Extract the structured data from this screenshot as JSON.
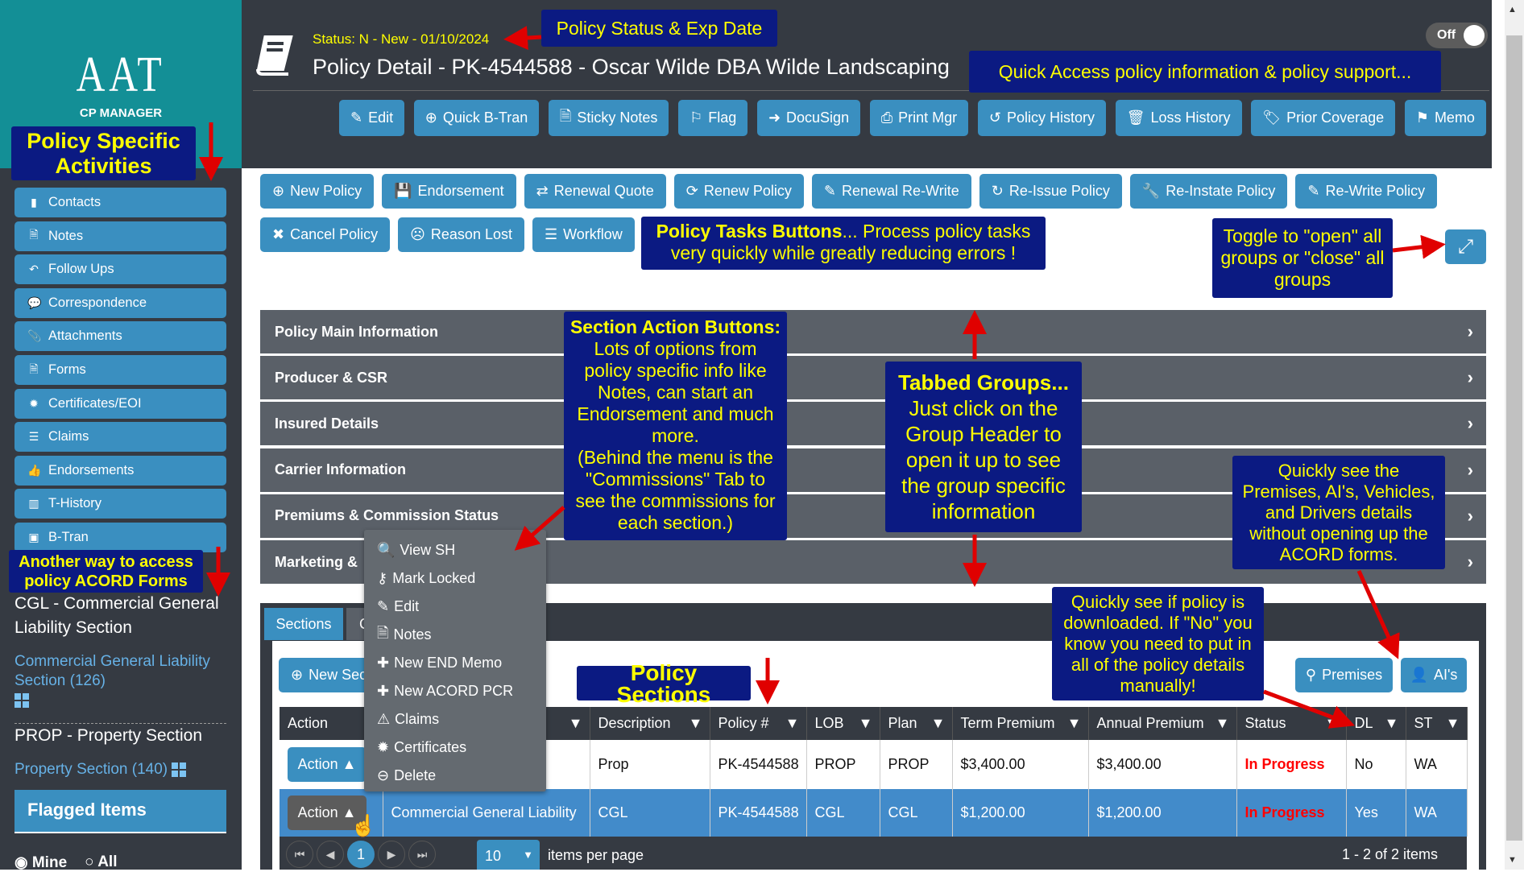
{
  "colors": {
    "accent": "#3a8fc0",
    "sidebar_bg": "#353a42",
    "brand_teal": "#138f96",
    "annotation_bg": "#0b1a82",
    "annotation_text": "#ffff00",
    "status_red": "#ff0000"
  },
  "logo": {
    "main": "AAT",
    "sub": "CP MANAGER"
  },
  "sidebar": {
    "items": [
      {
        "label": "Contacts",
        "icon": "address-book-icon"
      },
      {
        "label": "Notes",
        "icon": "file-icon"
      },
      {
        "label": "Follow Ups",
        "icon": "reply-icon"
      },
      {
        "label": "Correspondence",
        "icon": "comments-icon"
      },
      {
        "label": "Attachments",
        "icon": "paperclip-icon"
      },
      {
        "label": "Forms",
        "icon": "file-text-icon"
      },
      {
        "label": "Certificates/EOI",
        "icon": "certificate-icon"
      },
      {
        "label": "Claims",
        "icon": "list-icon"
      },
      {
        "label": "Endorsements",
        "icon": "thumbs-up-icon"
      },
      {
        "label": "T-History",
        "icon": "bar-chart-icon"
      },
      {
        "label": "B-Tran",
        "icon": "money-icon"
      }
    ],
    "sections": [
      {
        "title": "CGL - Commercial General Liability Section",
        "link": "Commercial General Liability Section (126)"
      },
      {
        "title": "PROP - Property Section",
        "link": "Property Section (140)"
      }
    ],
    "flagged_title": "Flagged Items",
    "radios": [
      {
        "label": "Mine",
        "checked": true
      },
      {
        "label": "All",
        "checked": false
      }
    ]
  },
  "header": {
    "status": "Status: N - New - 01/10/2024",
    "title": "Policy Detail - PK-4544588 - Oscar Wilde DBA Wilde Landscaping",
    "toggle_label": "Off",
    "buttons": [
      {
        "label": "Edit",
        "icon": "edit-icon"
      },
      {
        "label": "Quick B-Tran",
        "icon": "plus-circle-icon"
      },
      {
        "label": "Sticky Notes",
        "icon": "file-icon"
      },
      {
        "label": "Flag",
        "icon": "flag-icon"
      },
      {
        "label": "DocuSign",
        "icon": "sign-in-icon"
      },
      {
        "label": "Print Mgr",
        "icon": "print-icon"
      },
      {
        "label": "Policy History",
        "icon": "history-icon"
      },
      {
        "label": "Loss History",
        "icon": "trash-icon"
      },
      {
        "label": "Prior Coverage",
        "icon": "tags-icon"
      },
      {
        "label": "Memo",
        "icon": "bookmark-icon"
      }
    ]
  },
  "tasks": {
    "row1": [
      {
        "label": "New Policy",
        "icon": "plus-circle-icon"
      },
      {
        "label": "Endorsement",
        "icon": "save-icon"
      },
      {
        "label": "Renewal Quote",
        "icon": "retweet-icon"
      },
      {
        "label": "Renew Policy",
        "icon": "refresh-icon"
      },
      {
        "label": "Renewal Re-Write",
        "icon": "pencil-icon"
      },
      {
        "label": "Re-Issue Policy",
        "icon": "redo-icon"
      },
      {
        "label": "Re-Instate Policy",
        "icon": "wrench-icon"
      },
      {
        "label": "Re-Write Policy",
        "icon": "edit-square-icon"
      }
    ],
    "row2": [
      {
        "label": "Cancel Policy",
        "icon": "close-icon"
      },
      {
        "label": "Reason Lost",
        "icon": "frown-icon"
      },
      {
        "label": "Workflow",
        "icon": "tasks-icon"
      }
    ]
  },
  "groups": [
    "Policy Main Information",
    "Producer & CSR",
    "Insured Details",
    "Carrier Information",
    "Premiums & Commission Status",
    "Marketing & "
  ],
  "sections_panel": {
    "tabs": [
      "Sections",
      "C"
    ],
    "new_button": "New Sec",
    "premises_button": "Premises",
    "ais_button": "AI's",
    "columns": [
      "Action",
      "",
      "Description",
      "Policy #",
      "LOB",
      "Plan",
      "Term Premium",
      "Annual Premium",
      "Status",
      "DL",
      "ST"
    ],
    "rows": [
      {
        "action": "Action",
        "name": "",
        "description": "Prop",
        "policy": "PK-4544588",
        "lob": "PROP",
        "plan": "PROP",
        "term": "$3,400.00",
        "annual": "$3,400.00",
        "status": "In Progress",
        "dl": "No",
        "st": "WA"
      },
      {
        "action": "Action",
        "name": "Commercial General Liability",
        "description": "CGL",
        "policy": "PK-4544588",
        "lob": "CGL",
        "plan": "CGL",
        "term": "$1,200.00",
        "annual": "$1,200.00",
        "status": "In Progress",
        "dl": "Yes",
        "st": "WA"
      }
    ],
    "action_menu": [
      {
        "label": "View SH",
        "icon": "search-icon"
      },
      {
        "label": "Mark Locked",
        "icon": "key-icon"
      },
      {
        "label": "Edit",
        "icon": "edit-icon"
      },
      {
        "label": "Notes",
        "icon": "file-icon"
      },
      {
        "label": "New END Memo",
        "icon": "plus-icon"
      },
      {
        "label": "New ACORD PCR",
        "icon": "plus-icon"
      },
      {
        "label": "Claims",
        "icon": "warning-icon"
      },
      {
        "label": "Certificates",
        "icon": "certificate-icon"
      },
      {
        "label": "Delete",
        "icon": "minus-circle-icon"
      }
    ],
    "pager": {
      "current": "1",
      "page_size": "10",
      "per_page_label": "items per page",
      "summary": "1 - 2 of 2 items"
    }
  },
  "annotations": {
    "policy_specific": "Policy Specific Activities",
    "status_exp": "Policy Status & Exp Date",
    "quick_access": "Quick Access policy information & policy support...",
    "tasks_bold": "Policy Tasks Buttons",
    "tasks_rest": "... Process policy tasks very quickly while greatly reducing errors !",
    "toggle": "Toggle to \"open\" all groups or \"close\" all groups",
    "section_bold": "Section Action Buttons:",
    "section_rest": " Lots of options from policy specific info like Notes, can start an Endorsement and much more.",
    "section_extra": "(Behind the menu is the \"Commissions\" Tab to see the commissions for each section.)",
    "tabbed_bold": "Tabbed Groups...",
    "tabbed_rest": "Just click on the Group Header to open it up to see the group specific information",
    "premises": "Quickly see the Premises, AI's, Vehicles, and Drivers details without opening up the ACORD forms.",
    "downloaded": "Quickly see if policy is downloaded. If \"No\" you know you need to put in all of the policy details manually!",
    "acord_forms": "Another way to access policy ACORD Forms",
    "policy_sections": "Policy Sections"
  }
}
